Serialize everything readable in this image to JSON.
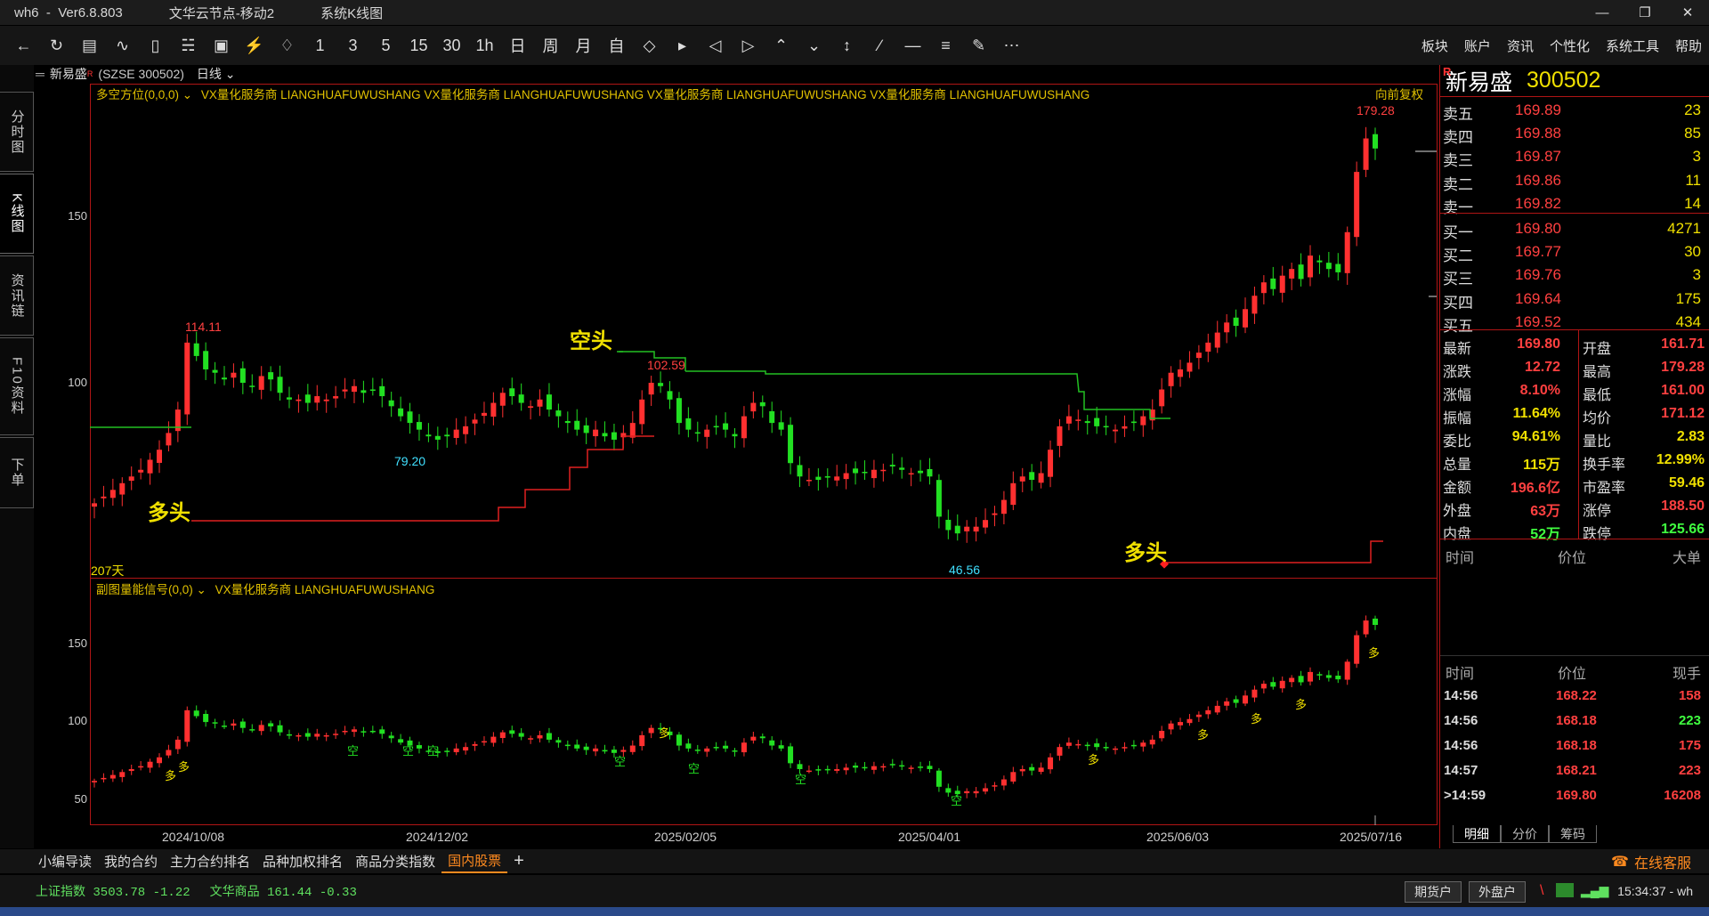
{
  "window": {
    "app": "wh6",
    "version": "Ver6.8.803",
    "node": "文华云节点-移动2",
    "system": "系统K线图"
  },
  "toolbar": {
    "icons": [
      "back-icon",
      "refresh-icon",
      "table-icon",
      "line-chart-icon",
      "bar-chart-icon",
      "candle-icon",
      "kline-icon",
      "cycle-icon",
      "bell-icon"
    ],
    "periods": [
      "1",
      "3",
      "5",
      "15",
      "30",
      "1h",
      "日",
      "周",
      "月",
      "自"
    ],
    "icons2": [
      "expand-icon",
      "compress-icon",
      "prev-icon",
      "next-icon",
      "up-icon",
      "down-icon",
      "crosshair-icon",
      "line-icon",
      "hline-icon",
      "text-icon",
      "eraser-icon",
      "more-icon"
    ],
    "menus": [
      "板块",
      "账户",
      "资讯",
      "个性化",
      "系统工具",
      "帮助"
    ]
  },
  "sidetabs": [
    "分时图",
    "K线图",
    "资讯链",
    "F10资料",
    "下单"
  ],
  "chart_header": {
    "name": "新易盛",
    "superscript": "R",
    "code": "(SZSE 300502)",
    "period": "日线"
  },
  "main_indicator": {
    "title": "多空方位(0,0,0)",
    "text": "VX量化服务商 LIANGHUAFUWUSHANG VX量化服务商 LIANGHUAFUWUSHANG VX量化服务商 LIANGHUAFUWUSHANG VX量化服务商 LIANGHUAFUWUSHANG",
    "restore": "向前复权"
  },
  "sub_indicator": {
    "title": "副图量能信号(0,0)",
    "text": "VX量化服务商 LIANGHUAFUWUSHANG"
  },
  "days_label": "207天",
  "annotations": {
    "long1": "多头",
    "short1": "空头",
    "long2": "多头",
    "sig_long": "多",
    "sig_short": "空"
  },
  "chart_data": {
    "type": "candlestick",
    "main_yticks": [
      150.0,
      100.0
    ],
    "sub_yticks": [
      150.0,
      100.0,
      50.0
    ],
    "xticks": [
      "2024/10/08",
      "2024/12/02",
      "2025/02/05",
      "2025/04/01",
      "2025/06/03",
      "2025/07/16"
    ],
    "price_labels": [
      {
        "label": "114.11",
        "color": "#ff4040"
      },
      {
        "label": "79.20",
        "color": "#40e0ff"
      },
      {
        "label": "102.59",
        "color": "#ff4040"
      },
      {
        "label": "46.56",
        "color": "#40e0ff"
      },
      {
        "label": "179.28",
        "color": "#ff4040"
      }
    ],
    "closes": [
      64,
      66,
      68,
      70,
      72,
      74,
      77,
      80,
      85,
      92,
      112,
      108,
      104,
      103,
      101,
      103,
      100,
      99,
      102,
      101,
      97,
      95,
      95,
      94,
      96,
      95,
      96,
      98,
      99,
      97,
      98,
      96,
      93,
      90,
      88,
      86,
      84,
      83,
      84,
      86,
      87,
      89,
      91,
      94,
      97,
      96,
      94,
      93,
      95,
      92,
      90,
      88,
      86,
      85,
      86,
      84,
      83,
      85,
      88,
      95,
      100,
      99,
      95,
      88,
      86,
      85,
      86,
      87,
      86,
      84,
      90,
      94,
      93,
      88,
      86,
      76,
      72,
      71,
      71,
      72,
      72,
      73,
      73,
      73,
      74,
      74,
      75,
      74,
      73,
      73,
      72,
      60,
      56,
      55,
      57,
      57,
      59,
      61,
      65,
      70,
      72,
      71,
      73,
      80,
      87,
      90,
      89,
      88,
      87,
      87,
      86,
      87,
      88,
      90,
      92,
      98,
      103,
      104,
      106,
      109,
      112,
      115,
      118,
      117,
      122,
      126,
      130,
      128,
      132,
      134,
      131,
      138,
      136,
      134,
      133,
      145,
      163,
      173,
      170
    ]
  },
  "quote": {
    "name": "新易盛",
    "code": "300502",
    "flag": "R",
    "asks": [
      {
        "label": "卖五",
        "price": "169.89",
        "vol": "23"
      },
      {
        "label": "卖四",
        "price": "169.88",
        "vol": "85"
      },
      {
        "label": "卖三",
        "price": "169.87",
        "vol": "3"
      },
      {
        "label": "卖二",
        "price": "169.86",
        "vol": "11"
      },
      {
        "label": "卖一",
        "price": "169.82",
        "vol": "14"
      }
    ],
    "bids": [
      {
        "label": "买一",
        "price": "169.80",
        "vol": "4271"
      },
      {
        "label": "买二",
        "price": "169.77",
        "vol": "30"
      },
      {
        "label": "买三",
        "price": "169.76",
        "vol": "3"
      },
      {
        "label": "买四",
        "price": "169.64",
        "vol": "175"
      },
      {
        "label": "买五",
        "price": "169.52",
        "vol": "434"
      }
    ],
    "stats": [
      {
        "l": "最新",
        "v": "169.80",
        "c": "#ff4040",
        "l2": "开盘",
        "v2": "161.71",
        "c2": "#ff4040"
      },
      {
        "l": "涨跌",
        "v": "12.72",
        "c": "#ff4040",
        "l2": "最高",
        "v2": "179.28",
        "c2": "#ff4040"
      },
      {
        "l": "涨幅",
        "v": "8.10%",
        "c": "#ff4040",
        "l2": "最低",
        "v2": "161.00",
        "c2": "#ff4040"
      },
      {
        "l": "振幅",
        "v": "11.64%",
        "c": "#f0e000",
        "l2": "均价",
        "v2": "171.12",
        "c2": "#ff4040"
      },
      {
        "l": "委比",
        "v": "94.61%",
        "c": "#f0e000",
        "l2": "量比",
        "v2": "2.83",
        "c2": "#f0e000"
      },
      {
        "l": "总量",
        "v": "115万",
        "c": "#f0e000",
        "l2": "换手率",
        "v2": "12.99%",
        "c2": "#f0e000"
      },
      {
        "l": "金额",
        "v": "196.6亿",
        "c": "#ff4040",
        "l2": "市盈率",
        "v2": "59.46",
        "c2": "#f0e000"
      },
      {
        "l": "外盘",
        "v": "63万",
        "c": "#ff4040",
        "l2": "涨停",
        "v2": "188.50",
        "c2": "#ff4040"
      },
      {
        "l": "内盘",
        "v": "52万",
        "c": "#40ff40",
        "l2": "跌停",
        "v2": "125.66",
        "c2": "#40ff40"
      }
    ],
    "big_head": [
      "时间",
      "价位",
      "大单"
    ],
    "tick_head": [
      "时间",
      "价位",
      "现手"
    ],
    "ticks": [
      {
        "t": "14:56",
        "p": "168.22",
        "v": "158",
        "vc": "#ff4040"
      },
      {
        "t": "14:56",
        "p": "168.18",
        "v": "223",
        "vc": "#40ff40"
      },
      {
        "t": "14:56",
        "p": "168.18",
        "v": "175",
        "vc": "#ff4040"
      },
      {
        "t": "14:57",
        "p": "168.21",
        "v": "223",
        "vc": "#ff4040"
      },
      {
        "t": ">14:59",
        "p": "169.80",
        "v": "16208",
        "vc": "#ff4040"
      }
    ],
    "tabs": [
      "明细",
      "分价",
      "筹码"
    ]
  },
  "bottom_tabs": [
    "小编导读",
    "我的合约",
    "主力合约排名",
    "品种加权排名",
    "商品分类指数",
    "国内股票"
  ],
  "customer_service": "在线客服",
  "status": {
    "idx1": "上证指数 3503.78 -1.22",
    "idx2": "文华商品 161.44 -0.33",
    "btn1": "期货户",
    "btn2": "外盘户",
    "clock": "15:34:37 - wh"
  }
}
